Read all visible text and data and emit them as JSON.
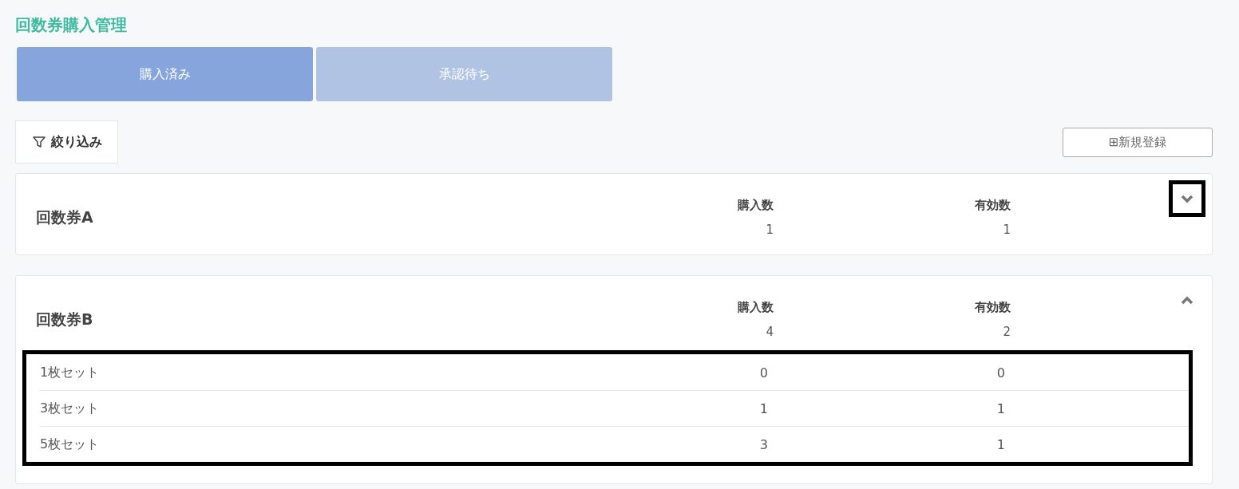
{
  "title": "回数券購入管理",
  "tabs": [
    {
      "label": "購入済み",
      "selected": true
    },
    {
      "label": "承認待ち",
      "selected": false
    }
  ],
  "filter_button": "絞り込み",
  "new_button": "⊞新規登録",
  "cards": [
    {
      "name": "回数券A",
      "purchased_label": "購入数",
      "purchased": "1",
      "valid_label": "有効数",
      "valid": "1",
      "expanded": false,
      "toggle_highlighted": true
    },
    {
      "name": "回数券B",
      "purchased_label": "購入数",
      "purchased": "4",
      "valid_label": "有効数",
      "valid": "2",
      "expanded": true,
      "toggle_highlighted": false,
      "details_highlighted": true,
      "details": [
        {
          "name": "1枚セット",
          "purchased": "0",
          "valid": "0"
        },
        {
          "name": "3枚セット",
          "purchased": "1",
          "valid": "1"
        },
        {
          "name": "5枚セット",
          "purchased": "3",
          "valid": "1"
        }
      ]
    }
  ]
}
